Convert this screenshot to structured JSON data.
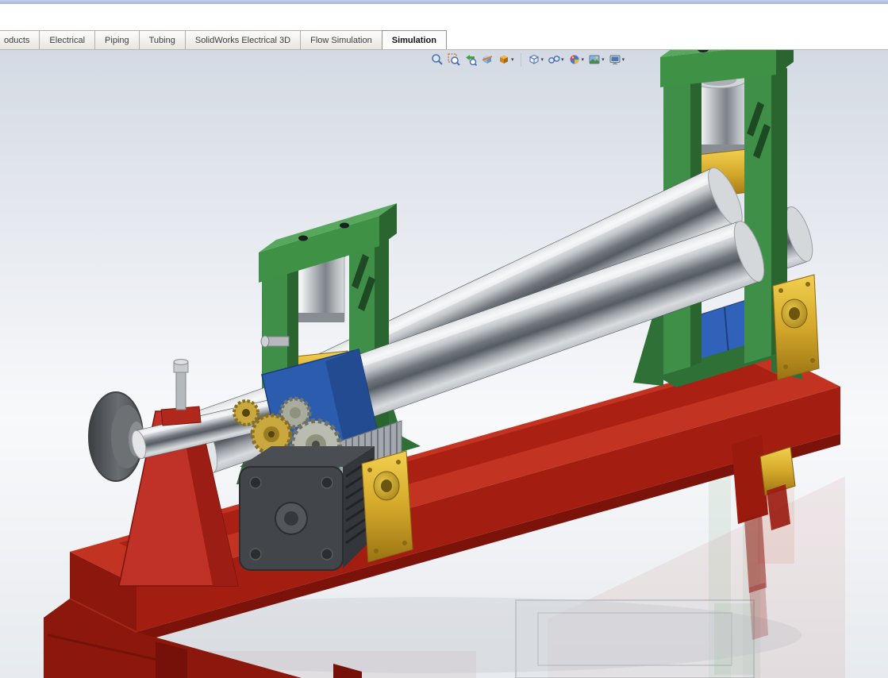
{
  "app": {
    "name": "SolidWorks"
  },
  "tabs": {
    "items": [
      {
        "label": "oducts",
        "active": false
      },
      {
        "label": "Electrical",
        "active": false
      },
      {
        "label": "Piping",
        "active": false
      },
      {
        "label": "Tubing",
        "active": false
      },
      {
        "label": "SolidWorks Electrical 3D",
        "active": false
      },
      {
        "label": "Flow Simulation",
        "active": false
      },
      {
        "label": "Simulation",
        "active": true
      }
    ]
  },
  "toolbar": {
    "icons": [
      {
        "name": "zoom-to-fit",
        "dropdown": false
      },
      {
        "name": "zoom-to-area",
        "dropdown": false
      },
      {
        "name": "previous-view",
        "dropdown": false
      },
      {
        "name": "section-view",
        "dropdown": false
      },
      {
        "name": "view-orientation",
        "dropdown": true
      },
      {
        "name": "display-style",
        "dropdown": true
      },
      {
        "name": "hide-show-items",
        "dropdown": true
      },
      {
        "name": "edit-appearance",
        "dropdown": true
      },
      {
        "name": "apply-scene",
        "dropdown": true
      },
      {
        "name": "view-settings",
        "dropdown": true
      }
    ]
  },
  "viewport": {
    "model": "three-roll-plate-bending-machine",
    "colors": {
      "base_red": "#b02718",
      "stand_green": "#3f8f48",
      "roller_chrome": "#9aa0a5",
      "bearing_gold": "#d4a82a",
      "gearbox_blue": "#2f62b8",
      "motor_gray": "#42464a"
    }
  }
}
